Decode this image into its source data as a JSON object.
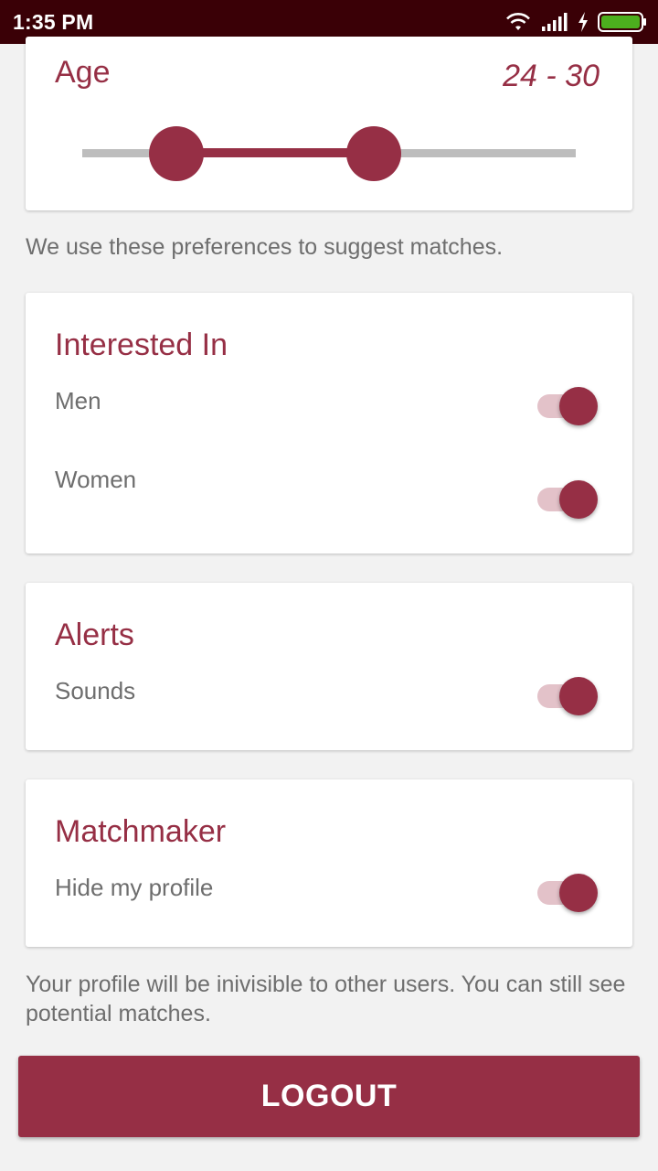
{
  "status_bar": {
    "time": "1:35 PM",
    "icons": [
      "wifi-icon",
      "cellular-signal-icon",
      "charging-bolt-icon",
      "battery-icon"
    ],
    "battery_color": "#4caf1e"
  },
  "theme": {
    "accent": "#962f45",
    "background": "#f2f2f2",
    "text_secondary": "#6e6e6e"
  },
  "age": {
    "title": "Age",
    "range_text": "24 - 30",
    "min_value": 24,
    "max_value": 30
  },
  "age_info": "We use these preferences to suggest matches.",
  "interested_in": {
    "title": "Interested In",
    "items": [
      {
        "label": "Men",
        "enabled": true
      },
      {
        "label": "Women",
        "enabled": true
      }
    ]
  },
  "alerts": {
    "title": "Alerts",
    "items": [
      {
        "label": "Sounds",
        "enabled": true
      }
    ]
  },
  "matchmaker": {
    "title": "Matchmaker",
    "items": [
      {
        "label": "Hide my profile",
        "enabled": true
      }
    ]
  },
  "matchmaker_info": "Your profile will be inivisible to other users. You can still see potential matches.",
  "logout_label": "LOGOUT"
}
